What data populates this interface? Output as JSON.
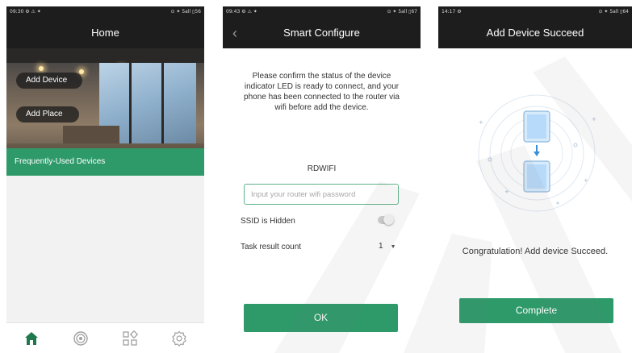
{
  "screen_home": {
    "status_left": "09:30 ⚙ ⚠ ✦",
    "status_right": "⊙ ✦ 5all ▯56",
    "title": "Home",
    "add_device_label": "Add Device",
    "add_place_label": "Add Place",
    "frequently_used_label": "Frequently-Used Devices",
    "tabs": [
      {
        "icon": "home-icon",
        "active": true
      },
      {
        "icon": "scan-icon",
        "active": false
      },
      {
        "icon": "grid-icon",
        "active": false
      },
      {
        "icon": "settings-icon",
        "active": false
      }
    ]
  },
  "screen_config": {
    "status_left": "09:43 ⚙ ⚠ ✦",
    "status_right": "⊙ ✦ 5all ▯67",
    "title": "Smart Configure",
    "instructions": "Please confirm the status of the device indicator LED is ready to connect, and your phone has been connected to the router via wifi before add the device.",
    "ssid": "RDWIFI",
    "password_placeholder": "Input your router wifi password",
    "ssid_hidden_label": "SSID is Hidden",
    "ssid_hidden_on": false,
    "task_result_label": "Task result count",
    "task_result_value": "1",
    "ok_label": "OK"
  },
  "screen_success": {
    "status_left": "14:17 ⚙",
    "status_right": "⊙ ✦ 5all ▯64",
    "title": "Add Device Succeed",
    "message": "Congratulation! Add device Succeed.",
    "complete_label": "Complete"
  },
  "colors": {
    "accent": "#2e9a6a",
    "header": "#1d1d1d",
    "tab_active": "#1e7a4c",
    "tab_inactive": "#a0a0a0"
  }
}
